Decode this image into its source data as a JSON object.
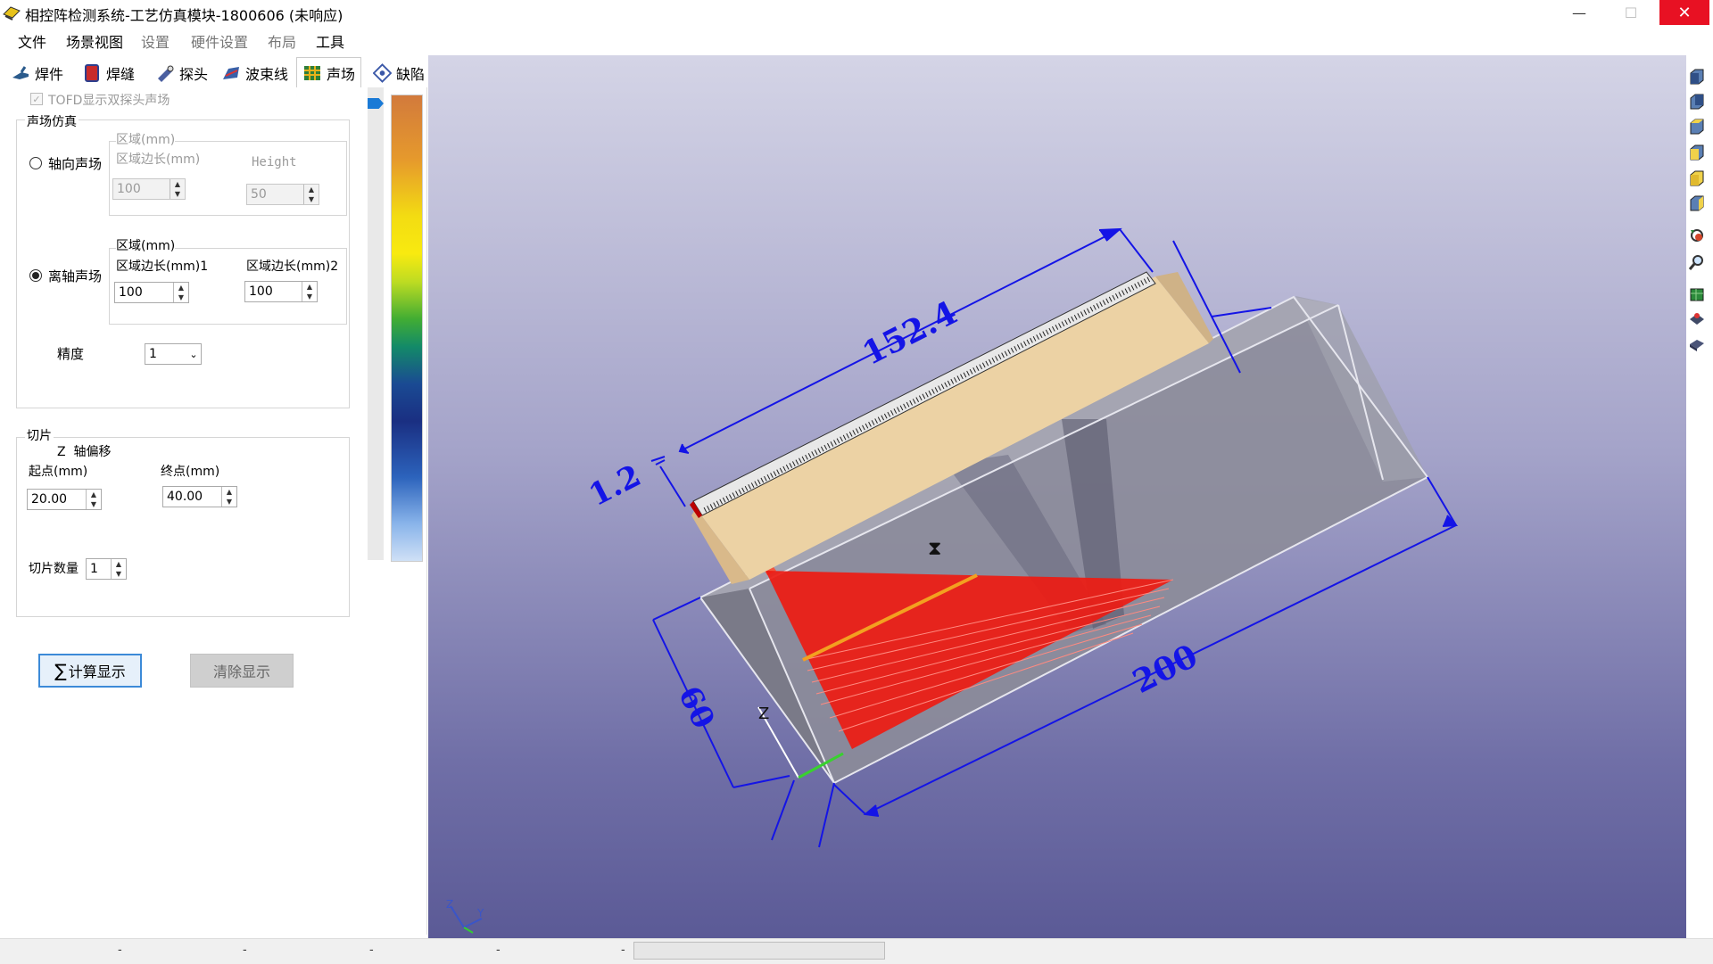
{
  "window": {
    "title": "相控阵检测系统-工艺仿真模块-1800606 (未响应)",
    "minimize_glyph": "—",
    "maximize_glyph": "☐",
    "close_glyph": "✕"
  },
  "menu": [
    {
      "label": "文件",
      "enabled": true
    },
    {
      "label": "场景视图",
      "enabled": true
    },
    {
      "label": "设置",
      "enabled": false
    },
    {
      "label": "硬件设置",
      "enabled": false
    },
    {
      "label": "布局",
      "enabled": false
    },
    {
      "label": "工具",
      "enabled": true
    }
  ],
  "tabs": [
    {
      "label": "焊件",
      "icon": "weldment-icon"
    },
    {
      "label": "焊缝",
      "icon": "weld-seam-icon"
    },
    {
      "label": "探头",
      "icon": "probe-icon"
    },
    {
      "label": "波束线",
      "icon": "beam-line-icon"
    },
    {
      "label": "声场",
      "icon": "sound-field-icon",
      "active": true
    },
    {
      "label": "缺陷",
      "icon": "defect-icon"
    }
  ],
  "panel": {
    "tofd_checkbox_label": "TOFD显示双探头声场",
    "tofd_checked": true,
    "sound_field_group": "声场仿真",
    "axial": {
      "radio_label": "轴向声场",
      "selected": false,
      "region_label": "区域(mm)",
      "edge_label": "区域边长(mm)",
      "height_label": "Height",
      "edge_value": "100",
      "height_value": "50"
    },
    "off_axis": {
      "radio_label": "离轴声场",
      "selected": true,
      "region_label": "区域(mm)",
      "edge1_label": "区域边长(mm)1",
      "edge2_label": "区域边长(mm)2",
      "edge1_value": "100",
      "edge2_value": "100"
    },
    "precision_label": "精度",
    "precision_value": "1",
    "slice_group": "切片",
    "z_offset_label": "Z  轴偏移",
    "start_label": "起点(mm)",
    "end_label": "终点(mm)",
    "start_value": "20.00",
    "end_value": "40.00",
    "slice_count_label": "切片数量",
    "slice_count_value": "1",
    "compute_button": "计算显示",
    "clear_button": "清除显示"
  },
  "viewport": {
    "dimension_labels": {
      "probe_length": "152.4",
      "probe_gap": "1.2",
      "block_length": "200",
      "block_height": "60"
    },
    "axis_z": "Z",
    "triad_labels": [
      "Z",
      "Y"
    ],
    "hourglass": "⧗"
  },
  "status": [
    "-",
    "-",
    "-",
    "-",
    "-"
  ],
  "colors": {
    "accent": "#1a7ad6",
    "close_red": "#e81123",
    "dimension_blue": "#1414e6",
    "beam_red": "#ee1b12"
  }
}
